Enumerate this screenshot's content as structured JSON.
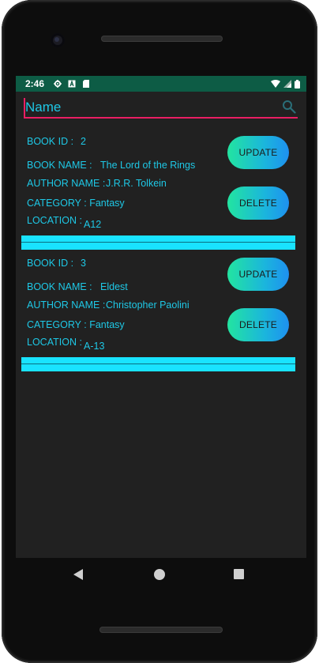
{
  "status_bar": {
    "time": "2:46",
    "icons": [
      "settings-icon",
      "a-icon",
      "sd-card-icon"
    ],
    "right_icons": [
      "wifi-icon",
      "signal-icon",
      "battery-icon"
    ]
  },
  "search": {
    "placeholder": "Name",
    "value": "",
    "icon": "search-icon"
  },
  "books": [
    {
      "id_label": "BOOK ID :",
      "id_value": "2",
      "name_label": "BOOK NAME :",
      "name_value": "The Lord of the Rings",
      "author_label": "AUTHOR NAME :",
      "author_value": "J.R.R. Tolkein",
      "category_label": "CATEGORY :",
      "category_value": "Fantasy",
      "location_label": "LOCATION :",
      "location_value": "A12",
      "update_label": "UPDATE",
      "delete_label": "DELETE"
    },
    {
      "id_label": "BOOK ID :",
      "id_value": "3",
      "name_label": "BOOK NAME :",
      "name_value": "Eldest",
      "author_label": "AUTHOR NAME :",
      "author_value": "Christopher Paolini",
      "category_label": "CATEGORY :",
      "category_value": "Fantasy",
      "location_label": "LOCATION :",
      "location_value": "A-13",
      "update_label": "UPDATE",
      "delete_label": "DELETE"
    }
  ],
  "nav": {
    "back": "back-icon",
    "home": "home-icon",
    "recents": "recents-icon"
  },
  "colors": {
    "background": "#212121",
    "status_bar": "#0d5c45",
    "text_accent": "#1ec8e6",
    "search_underline": "#e91e63",
    "divider": "#19e3ff",
    "button_gradient_start": "#22e4a0",
    "button_gradient_end": "#1e90f0"
  }
}
